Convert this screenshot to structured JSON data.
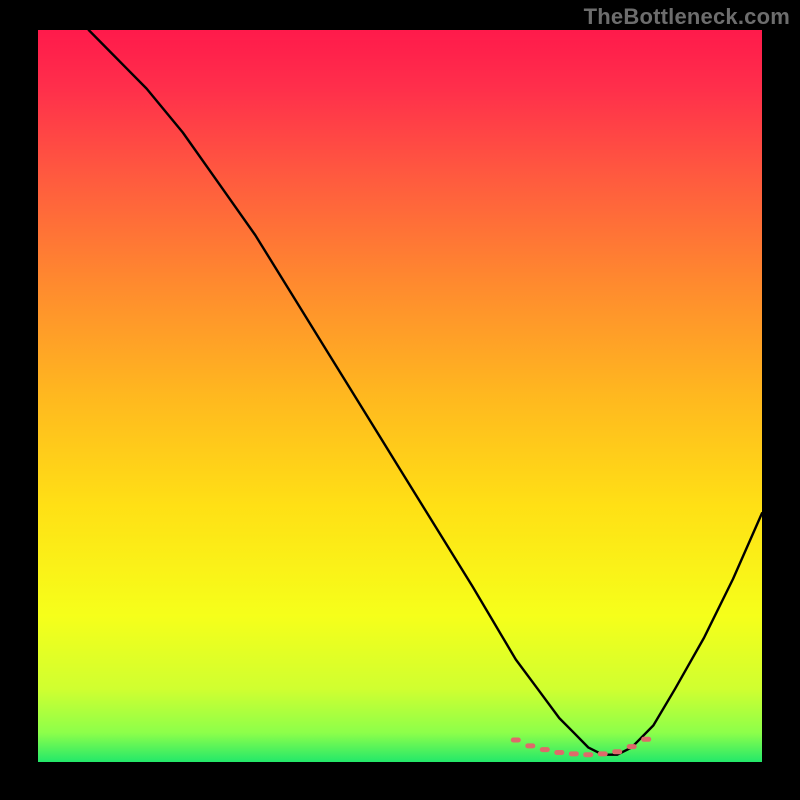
{
  "watermark": "TheBottleneck.com",
  "colors": {
    "frame": "#000000",
    "curve": "#000000",
    "marker": "#de6a6a",
    "gradient_stops": [
      {
        "offset": 0.0,
        "color": "#ff1a4b"
      },
      {
        "offset": 0.08,
        "color": "#ff2f4b"
      },
      {
        "offset": 0.2,
        "color": "#ff5a3f"
      },
      {
        "offset": 0.35,
        "color": "#ff8b2e"
      },
      {
        "offset": 0.5,
        "color": "#ffb81f"
      },
      {
        "offset": 0.65,
        "color": "#ffe015"
      },
      {
        "offset": 0.8,
        "color": "#f6ff1a"
      },
      {
        "offset": 0.9,
        "color": "#d0ff30"
      },
      {
        "offset": 0.96,
        "color": "#8dff4a"
      },
      {
        "offset": 1.0,
        "color": "#23e86a"
      }
    ]
  },
  "chart_data": {
    "type": "line",
    "title": "",
    "xlabel": "",
    "ylabel": "",
    "xlim": [
      0,
      100
    ],
    "ylim": [
      0,
      100
    ],
    "series": [
      {
        "name": "curve",
        "x": [
          7,
          10,
          15,
          20,
          25,
          30,
          35,
          40,
          45,
          50,
          55,
          60,
          63,
          66,
          69,
          72,
          74,
          76,
          78,
          80,
          82,
          85,
          88,
          92,
          96,
          100
        ],
        "y": [
          100,
          97,
          92,
          86,
          79,
          72,
          64,
          56,
          48,
          40,
          32,
          24,
          19,
          14,
          10,
          6,
          4,
          2,
          1,
          1,
          2,
          5,
          10,
          17,
          25,
          34
        ]
      }
    ],
    "markers": {
      "name": "highlight-band",
      "x": [
        66,
        68,
        70,
        72,
        74,
        76,
        78,
        80,
        82,
        84
      ],
      "y": [
        3.0,
        2.2,
        1.7,
        1.3,
        1.1,
        1.0,
        1.1,
        1.4,
        2.1,
        3.1
      ]
    }
  }
}
